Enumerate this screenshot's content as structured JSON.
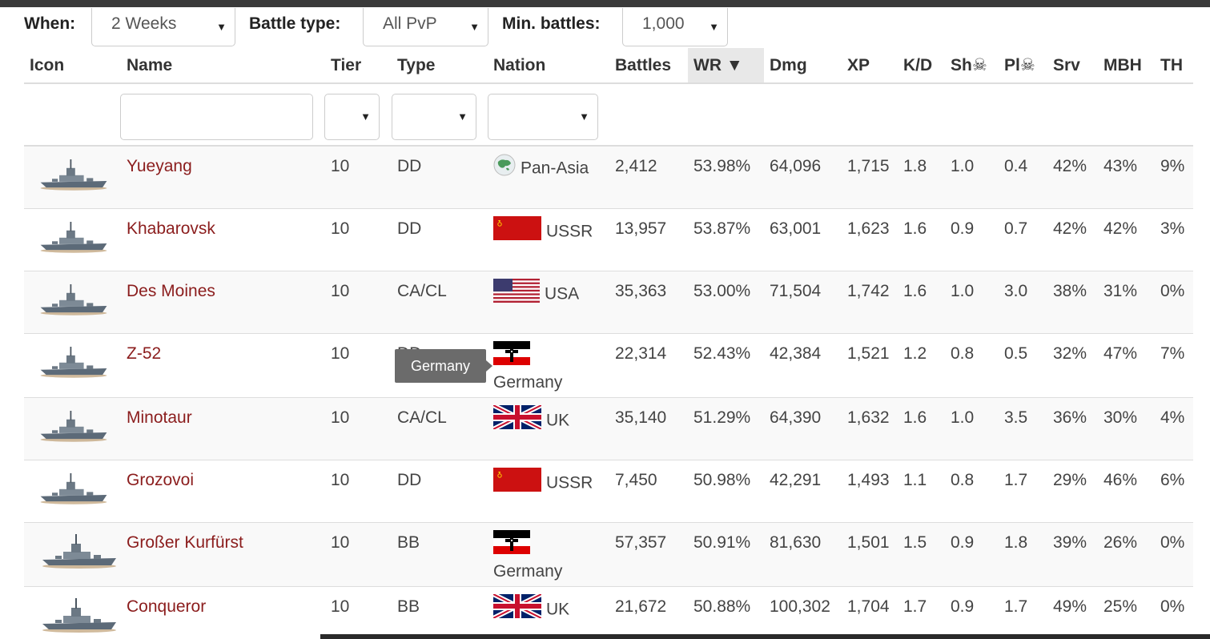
{
  "filters": {
    "when_label": "When:",
    "when_value": "2 Weeks",
    "battle_type_label": "Battle type:",
    "battle_type_value": "All PvP",
    "min_battles_label": "Min. battles:",
    "min_battles_value": "1,000"
  },
  "columns": {
    "icon": "Icon",
    "name": "Name",
    "tier": "Tier",
    "type": "Type",
    "nation": "Nation",
    "battles": "Battles",
    "wr": "WR ▼",
    "dmg": "Dmg",
    "xp": "XP",
    "kd": "K/D",
    "sh": "Sh☠",
    "pl": "Pl☠",
    "srv": "Srv",
    "mbh": "MBH",
    "th": "TH"
  },
  "tooltip": "Germany",
  "rows": [
    {
      "name": "Yueyang",
      "tier": "10",
      "type": "DD",
      "nation": "Pan-Asia",
      "flag": "pan-asia",
      "battles": "2,412",
      "wr": "53.98%",
      "dmg": "64,096",
      "xp": "1,715",
      "kd": "1.8",
      "sh": "1.0",
      "pl": "0.4",
      "srv": "42%",
      "mbh": "43%",
      "th": "9%"
    },
    {
      "name": "Khabarovsk",
      "tier": "10",
      "type": "DD",
      "nation": "USSR",
      "flag": "ussr",
      "battles": "13,957",
      "wr": "53.87%",
      "dmg": "63,001",
      "xp": "1,623",
      "kd": "1.6",
      "sh": "0.9",
      "pl": "0.7",
      "srv": "42%",
      "mbh": "42%",
      "th": "3%"
    },
    {
      "name": "Des Moines",
      "tier": "10",
      "type": "CA/CL",
      "nation": "USA",
      "flag": "usa",
      "battles": "35,363",
      "wr": "53.00%",
      "dmg": "71,504",
      "xp": "1,742",
      "kd": "1.6",
      "sh": "1.0",
      "pl": "3.0",
      "srv": "38%",
      "mbh": "31%",
      "th": "0%"
    },
    {
      "name": "Z-52",
      "tier": "10",
      "type": "DD",
      "nation": "Germany",
      "flag": "germany",
      "battles": "22,314",
      "wr": "52.43%",
      "dmg": "42,384",
      "xp": "1,521",
      "kd": "1.2",
      "sh": "0.8",
      "pl": "0.5",
      "srv": "32%",
      "mbh": "47%",
      "th": "7%"
    },
    {
      "name": "Minotaur",
      "tier": "10",
      "type": "CA/CL",
      "nation": "UK",
      "flag": "uk",
      "battles": "35,140",
      "wr": "51.29%",
      "dmg": "64,390",
      "xp": "1,632",
      "kd": "1.6",
      "sh": "1.0",
      "pl": "3.5",
      "srv": "36%",
      "mbh": "30%",
      "th": "4%"
    },
    {
      "name": "Grozovoi",
      "tier": "10",
      "type": "DD",
      "nation": "USSR",
      "flag": "ussr",
      "battles": "7,450",
      "wr": "50.98%",
      "dmg": "42,291",
      "xp": "1,493",
      "kd": "1.1",
      "sh": "0.8",
      "pl": "1.7",
      "srv": "29%",
      "mbh": "46%",
      "th": "6%"
    },
    {
      "name": "Großer Kurfürst",
      "tier": "10",
      "type": "BB",
      "nation": "Germany",
      "flag": "germany",
      "battles": "57,357",
      "wr": "50.91%",
      "dmg": "81,630",
      "xp": "1,501",
      "kd": "1.5",
      "sh": "0.9",
      "pl": "1.8",
      "srv": "39%",
      "mbh": "26%",
      "th": "0%"
    },
    {
      "name": "Conqueror",
      "tier": "10",
      "type": "BB",
      "nation": "UK",
      "flag": "uk",
      "battles": "21,672",
      "wr": "50.88%",
      "dmg": "100,302",
      "xp": "1,704",
      "kd": "1.7",
      "sh": "0.9",
      "pl": "1.7",
      "srv": "49%",
      "mbh": "25%",
      "th": "0%"
    }
  ]
}
